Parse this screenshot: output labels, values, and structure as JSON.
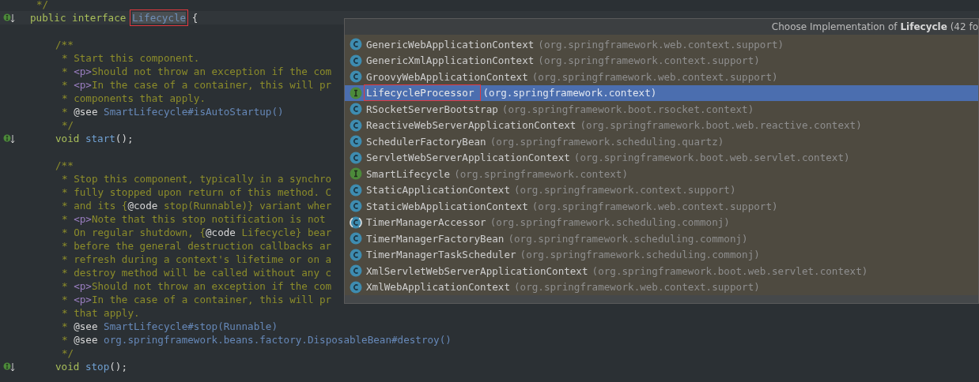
{
  "editor": {
    "lines": [
      {
        "kind": "doc-close",
        "tokens": [
          {
            "kind": "comment",
            "text": "*/"
          }
        ]
      },
      {
        "kind": "code",
        "marker": true,
        "tokens": [
          {
            "kind": "keyword",
            "text": "public interface "
          },
          {
            "kind": "name",
            "text": "Lifecycle",
            "outlined": true
          },
          {
            "kind": "plain",
            "text": " {"
          }
        ]
      },
      {
        "kind": "blank"
      },
      {
        "kind": "doc-open",
        "member": true,
        "tokens": [
          {
            "kind": "comment",
            "text": "/**"
          }
        ]
      },
      {
        "kind": "doc",
        "member": true,
        "tokens": [
          {
            "kind": "comment",
            "text": "* Start this component."
          }
        ]
      },
      {
        "kind": "doc",
        "member": true,
        "tokens": [
          {
            "kind": "comment",
            "text": "* "
          },
          {
            "kind": "tag",
            "text": "<p>"
          },
          {
            "kind": "comment",
            "text": "Should not throw an exception if the com"
          }
        ]
      },
      {
        "kind": "doc",
        "member": true,
        "tokens": [
          {
            "kind": "comment",
            "text": "* "
          },
          {
            "kind": "tag",
            "text": "<p>"
          },
          {
            "kind": "comment",
            "text": "In the case of a container, this will pr"
          }
        ]
      },
      {
        "kind": "doc",
        "member": true,
        "tokens": [
          {
            "kind": "comment",
            "text": "* components that apply."
          }
        ]
      },
      {
        "kind": "doc",
        "member": true,
        "tokens": [
          {
            "kind": "comment",
            "text": "* "
          },
          {
            "kind": "plain",
            "text": "@see "
          },
          {
            "kind": "link",
            "text": "SmartLifecycle#isAutoStartup()"
          }
        ]
      },
      {
        "kind": "doc-close",
        "member": true,
        "tokens": [
          {
            "kind": "comment",
            "text": "*/"
          }
        ]
      },
      {
        "kind": "code",
        "member": true,
        "marker": true,
        "tokens": [
          {
            "kind": "keyword",
            "text": "void "
          },
          {
            "kind": "method",
            "text": "start"
          },
          {
            "kind": "plain",
            "text": "();"
          }
        ]
      },
      {
        "kind": "blank"
      },
      {
        "kind": "doc-open",
        "member": true,
        "tokens": [
          {
            "kind": "comment",
            "text": "/**"
          }
        ]
      },
      {
        "kind": "doc",
        "member": true,
        "tokens": [
          {
            "kind": "comment",
            "text": "* Stop this component, typically in a synchro"
          }
        ]
      },
      {
        "kind": "doc",
        "member": true,
        "tokens": [
          {
            "kind": "comment",
            "text": "* fully stopped upon return of this method. C"
          }
        ]
      },
      {
        "kind": "doc",
        "member": true,
        "tokens": [
          {
            "kind": "comment",
            "text": "* and its {"
          },
          {
            "kind": "plain",
            "text": "@code"
          },
          {
            "kind": "comment",
            "text": " stop(Runnable)} variant wher"
          }
        ]
      },
      {
        "kind": "doc",
        "member": true,
        "tokens": [
          {
            "kind": "comment",
            "text": "* "
          },
          {
            "kind": "tag",
            "text": "<p>"
          },
          {
            "kind": "comment",
            "text": "Note that this stop notification is not"
          }
        ]
      },
      {
        "kind": "doc",
        "member": true,
        "tokens": [
          {
            "kind": "comment",
            "text": "* On regular shutdown, {"
          },
          {
            "kind": "plain",
            "text": "@code"
          },
          {
            "kind": "comment",
            "text": " Lifecycle} bear"
          }
        ]
      },
      {
        "kind": "doc",
        "member": true,
        "tokens": [
          {
            "kind": "comment",
            "text": "* before the general destruction callbacks ar"
          }
        ]
      },
      {
        "kind": "doc",
        "member": true,
        "tokens": [
          {
            "kind": "comment",
            "text": "* refresh during a context's lifetime or on a"
          }
        ]
      },
      {
        "kind": "doc",
        "member": true,
        "tokens": [
          {
            "kind": "comment",
            "text": "* destroy method will be called without any c"
          }
        ]
      },
      {
        "kind": "doc",
        "member": true,
        "tokens": [
          {
            "kind": "comment",
            "text": "* "
          },
          {
            "kind": "tag",
            "text": "<p>"
          },
          {
            "kind": "comment",
            "text": "Should not throw an exception if the com"
          }
        ]
      },
      {
        "kind": "doc",
        "member": true,
        "tokens": [
          {
            "kind": "comment",
            "text": "* "
          },
          {
            "kind": "tag",
            "text": "<p>"
          },
          {
            "kind": "comment",
            "text": "In the case of a container, this will pr"
          }
        ]
      },
      {
        "kind": "doc",
        "member": true,
        "tokens": [
          {
            "kind": "comment",
            "text": "* that apply."
          }
        ]
      },
      {
        "kind": "doc",
        "member": true,
        "tokens": [
          {
            "kind": "comment",
            "text": "* "
          },
          {
            "kind": "plain",
            "text": "@see "
          },
          {
            "kind": "link",
            "text": "SmartLifecycle#stop(Runnable)"
          }
        ]
      },
      {
        "kind": "doc",
        "member": true,
        "tokens": [
          {
            "kind": "comment",
            "text": "* "
          },
          {
            "kind": "plain",
            "text": "@see "
          },
          {
            "kind": "link",
            "text": "org.springframework.beans.factory.DisposableBean#destroy()"
          }
        ]
      },
      {
        "kind": "doc-close",
        "member": true,
        "tokens": [
          {
            "kind": "comment",
            "text": "*/"
          }
        ]
      },
      {
        "kind": "code",
        "member": true,
        "marker": true,
        "tokens": [
          {
            "kind": "keyword",
            "text": "void "
          },
          {
            "kind": "method",
            "text": "stop"
          },
          {
            "kind": "plain",
            "text": "();"
          }
        ]
      }
    ]
  },
  "popup": {
    "title": "Choose Implementation of **Lifecycle** (42 fo",
    "items": [
      {
        "kind": "class",
        "name": "GenericWebApplicationContext",
        "package": "(org.springframework.web.context.support)",
        "selected": false
      },
      {
        "kind": "class",
        "name": "GenericXmlApplicationContext",
        "package": "(org.springframework.context.support)",
        "selected": false
      },
      {
        "kind": "class",
        "name": "GroovyWebApplicationContext",
        "package": "(org.springframework.web.context.support)",
        "selected": false
      },
      {
        "kind": "interface",
        "name": "LifecycleProcessor",
        "package": "(org.springframework.context)",
        "selected": true,
        "outlined": true
      },
      {
        "kind": "class",
        "name": "RSocketServerBootstrap",
        "package": "(org.springframework.boot.rsocket.context)",
        "selected": false
      },
      {
        "kind": "class",
        "name": "ReactiveWebServerApplicationContext",
        "package": "(org.springframework.boot.web.reactive.context)",
        "selected": false
      },
      {
        "kind": "class",
        "name": "SchedulerFactoryBean",
        "package": "(org.springframework.scheduling.quartz)",
        "selected": false
      },
      {
        "kind": "class",
        "name": "ServletWebServerApplicationContext",
        "package": "(org.springframework.boot.web.servlet.context)",
        "selected": false
      },
      {
        "kind": "interface",
        "name": "SmartLifecycle",
        "package": "(org.springframework.context)",
        "selected": false
      },
      {
        "kind": "class",
        "name": "StaticApplicationContext",
        "package": "(org.springframework.context.support)",
        "selected": false
      },
      {
        "kind": "class",
        "name": "StaticWebApplicationContext",
        "package": "(org.springframework.web.context.support)",
        "selected": false
      },
      {
        "kind": "abstract",
        "name": "TimerManagerAccessor",
        "package": "(org.springframework.scheduling.commonj)",
        "selected": false
      },
      {
        "kind": "class",
        "name": "TimerManagerFactoryBean",
        "package": "(org.springframework.scheduling.commonj)",
        "selected": false
      },
      {
        "kind": "class",
        "name": "TimerManagerTaskScheduler",
        "package": "(org.springframework.scheduling.commonj)",
        "selected": false
      },
      {
        "kind": "class",
        "name": "XmlServletWebServerApplicationContext",
        "package": "(org.springframework.boot.web.servlet.context)",
        "selected": false
      },
      {
        "kind": "class",
        "name": "XmlWebApplicationContext",
        "package": "(org.springframework.web.context.support)",
        "selected": false
      }
    ]
  }
}
